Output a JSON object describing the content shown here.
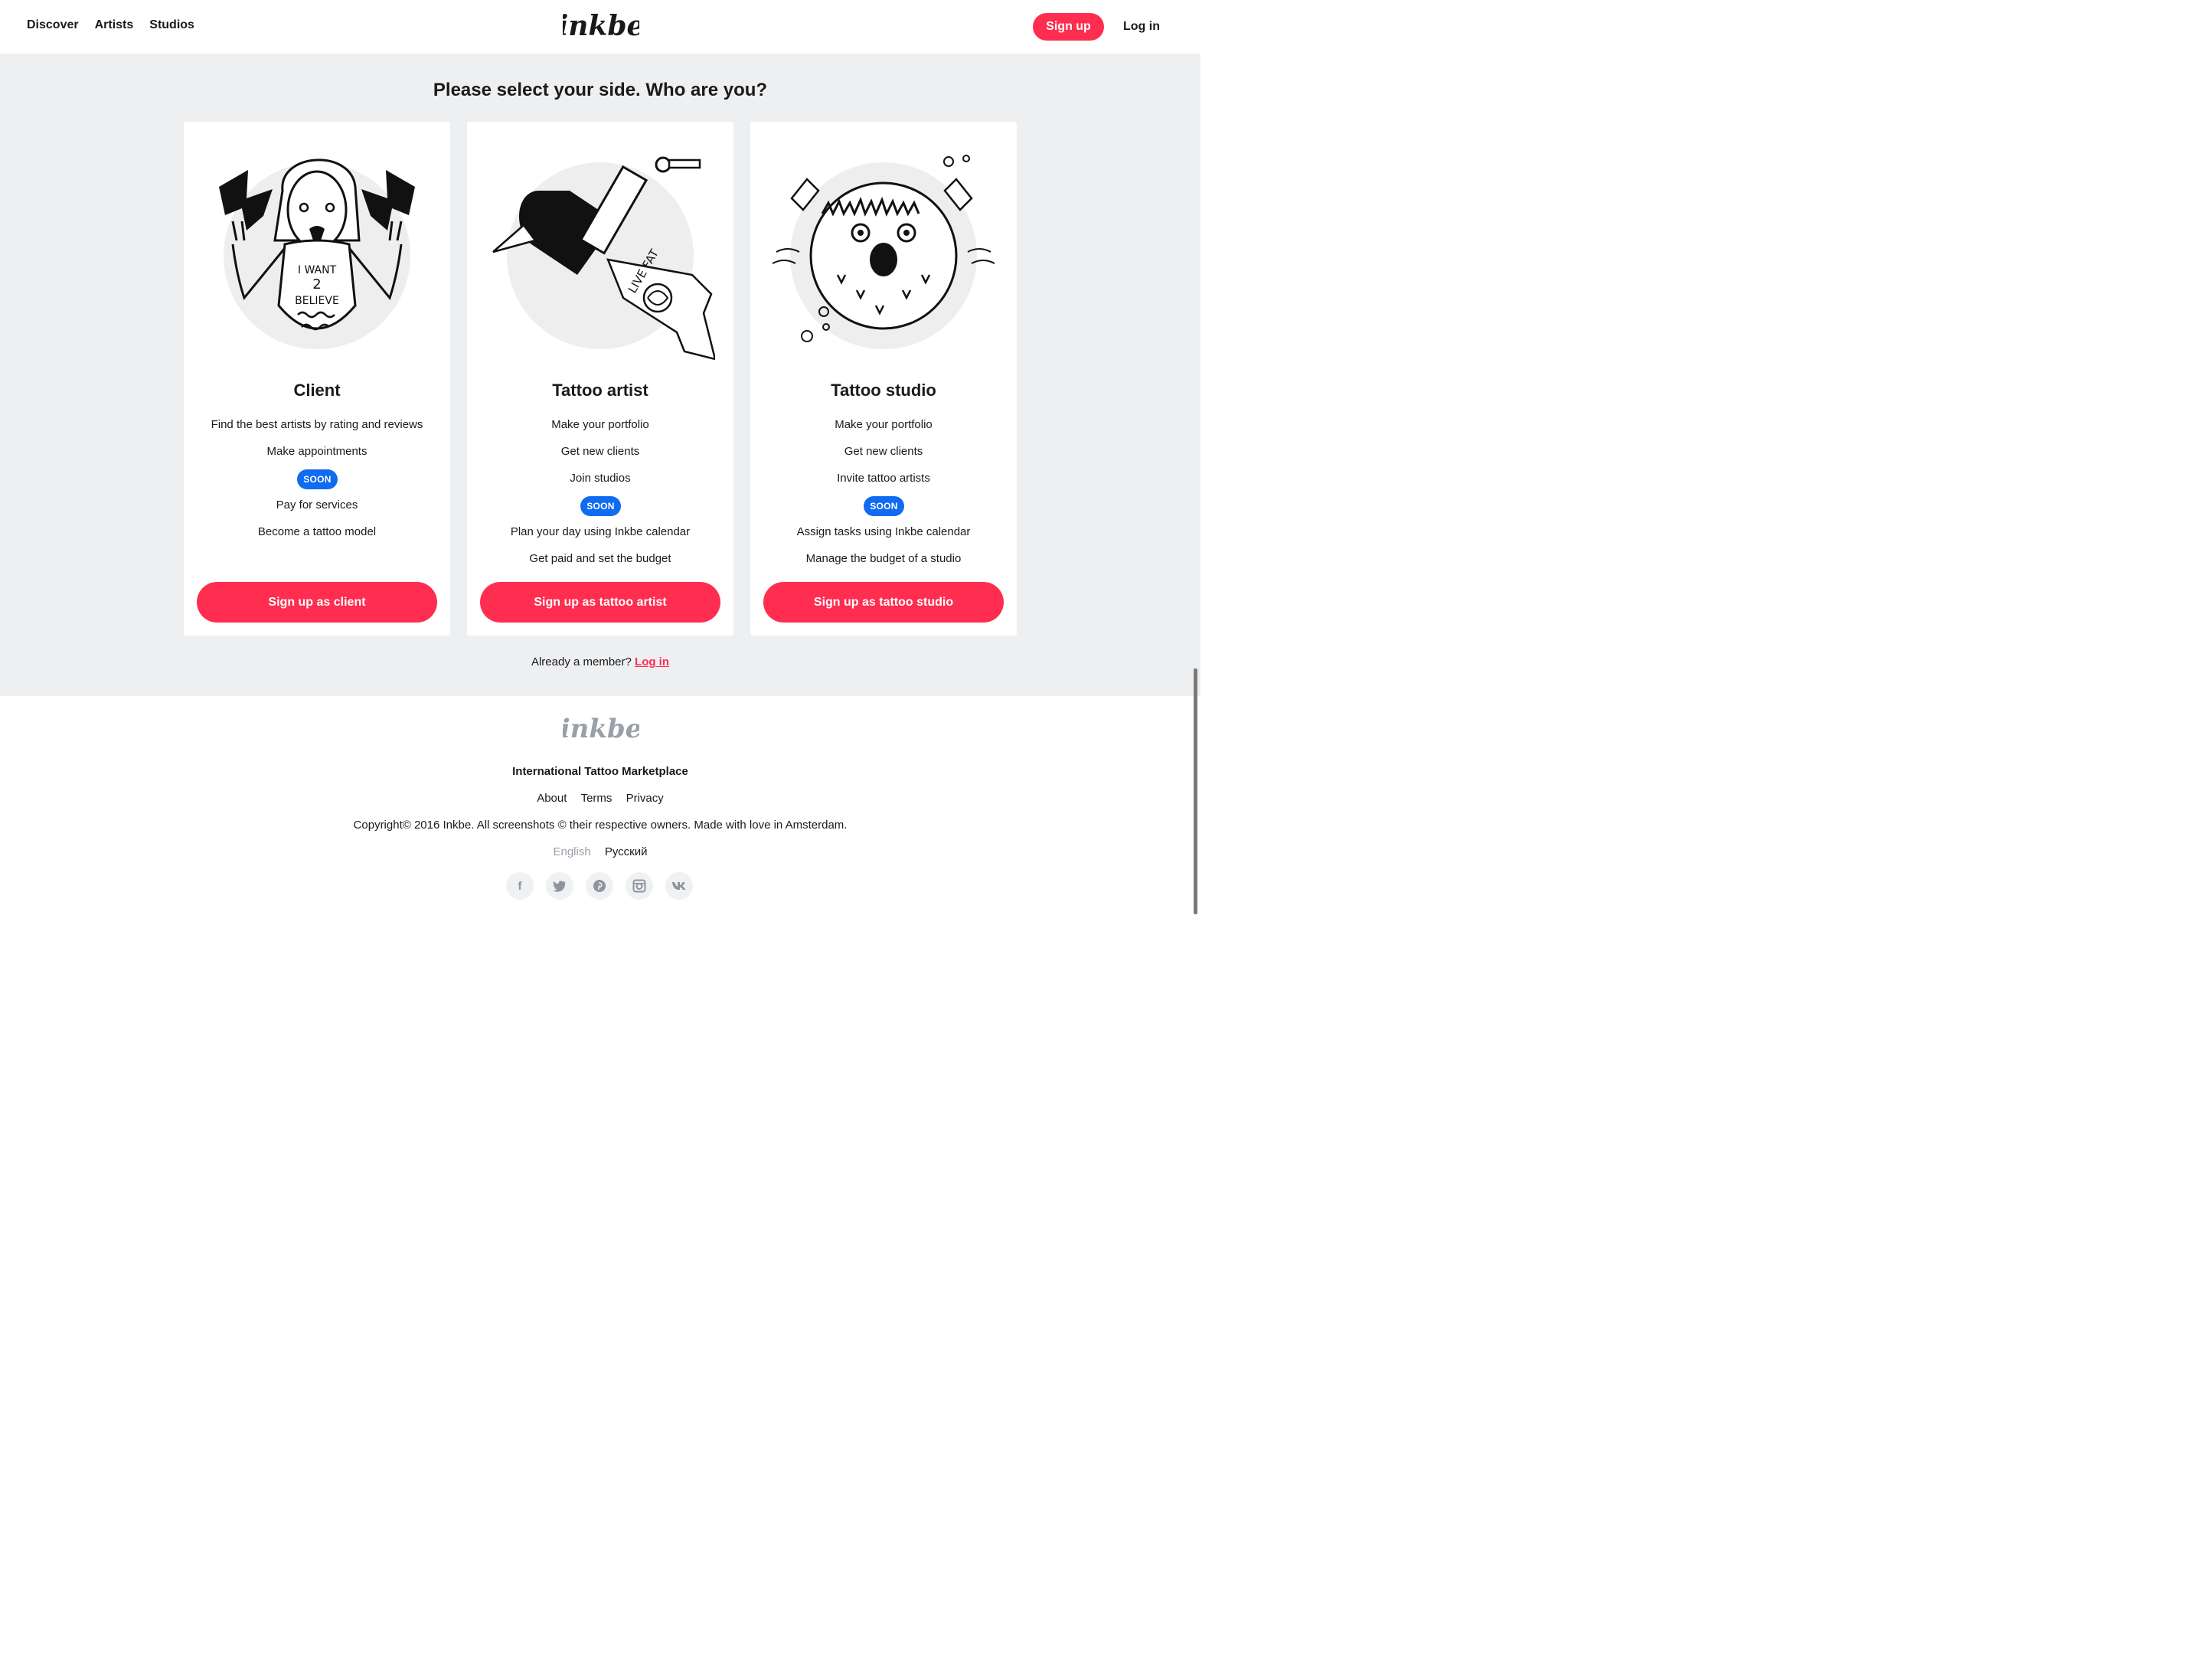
{
  "header": {
    "nav": [
      "Discover",
      "Artists",
      "Studios"
    ],
    "logo_text": "inkbe",
    "signup_label": "Sign up",
    "login_label": "Log in"
  },
  "main": {
    "heading": "Please select your side. Who are you?",
    "cards": [
      {
        "title": "Client",
        "features": [
          "Find the best artists by rating and reviews",
          "Make appointments"
        ],
        "soon_label": "SOON",
        "soon_features": [
          "Pay for services",
          "Become a tattoo model"
        ],
        "cta": "Sign up as client",
        "shirt_text": [
          "I WANT",
          "2",
          "BELIEVE"
        ]
      },
      {
        "title": "Tattoo artist",
        "features": [
          "Make your portfolio",
          "Get new clients",
          "Join studios"
        ],
        "soon_label": "SOON",
        "soon_features": [
          "Plan your day using Inkbe calendar",
          "Get paid and set the budget"
        ],
        "cta": "Sign up as tattoo artist",
        "banner_text": "LIVE FAT"
      },
      {
        "title": "Tattoo studio",
        "features": [
          "Make your portfolio",
          "Get new clients",
          "Invite tattoo artists"
        ],
        "soon_label": "SOON",
        "soon_features": [
          "Assign tasks using Inkbe calendar",
          "Manage the budget of a studio"
        ],
        "cta": "Sign up as tattoo studio"
      }
    ],
    "member_text": "Already a member?",
    "member_link": "Log in"
  },
  "footer": {
    "logo_text": "inkbe",
    "tagline": "International Tattoo Marketplace",
    "links": [
      "About",
      "Terms",
      "Privacy"
    ],
    "copyright": "Copyright© 2016 Inkbe. All screenshots © their respective owners. Made with love in Amsterdam.",
    "languages": [
      "English",
      "Русский"
    ],
    "social": [
      "facebook-icon",
      "twitter-icon",
      "pinterest-icon",
      "instagram-icon",
      "vk-icon"
    ]
  },
  "colors": {
    "accent": "#ff2d4f",
    "soon_badge": "#0f6bf0",
    "band_bg": "#eeeff1"
  }
}
